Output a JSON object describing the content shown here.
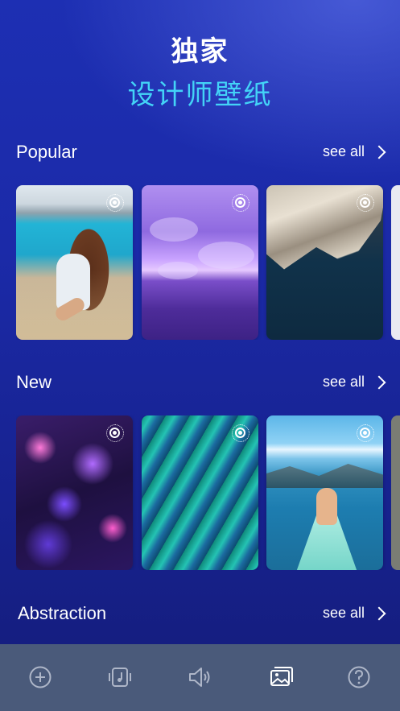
{
  "hero": {
    "title": "独家",
    "subtitle": "设计师壁纸"
  },
  "sections": [
    {
      "title": "Popular",
      "see_all": "see all"
    },
    {
      "title": "New",
      "see_all": "see all"
    },
    {
      "title": "Abstraction",
      "see_all": "see all"
    }
  ],
  "tabbar": {
    "active": "wallpapers",
    "items": [
      {
        "icon": "add-circle-icon"
      },
      {
        "icon": "music-vibration-icon"
      },
      {
        "icon": "speaker-icon"
      },
      {
        "icon": "wallpaper-gallery-icon"
      },
      {
        "icon": "help-circle-icon"
      }
    ]
  },
  "colors": {
    "accent_cyan": "#43d3f7",
    "tabbar_bg": "#4a5a7a",
    "tab_active": "#ffffff",
    "tab_inactive": "#aeb6c8"
  }
}
